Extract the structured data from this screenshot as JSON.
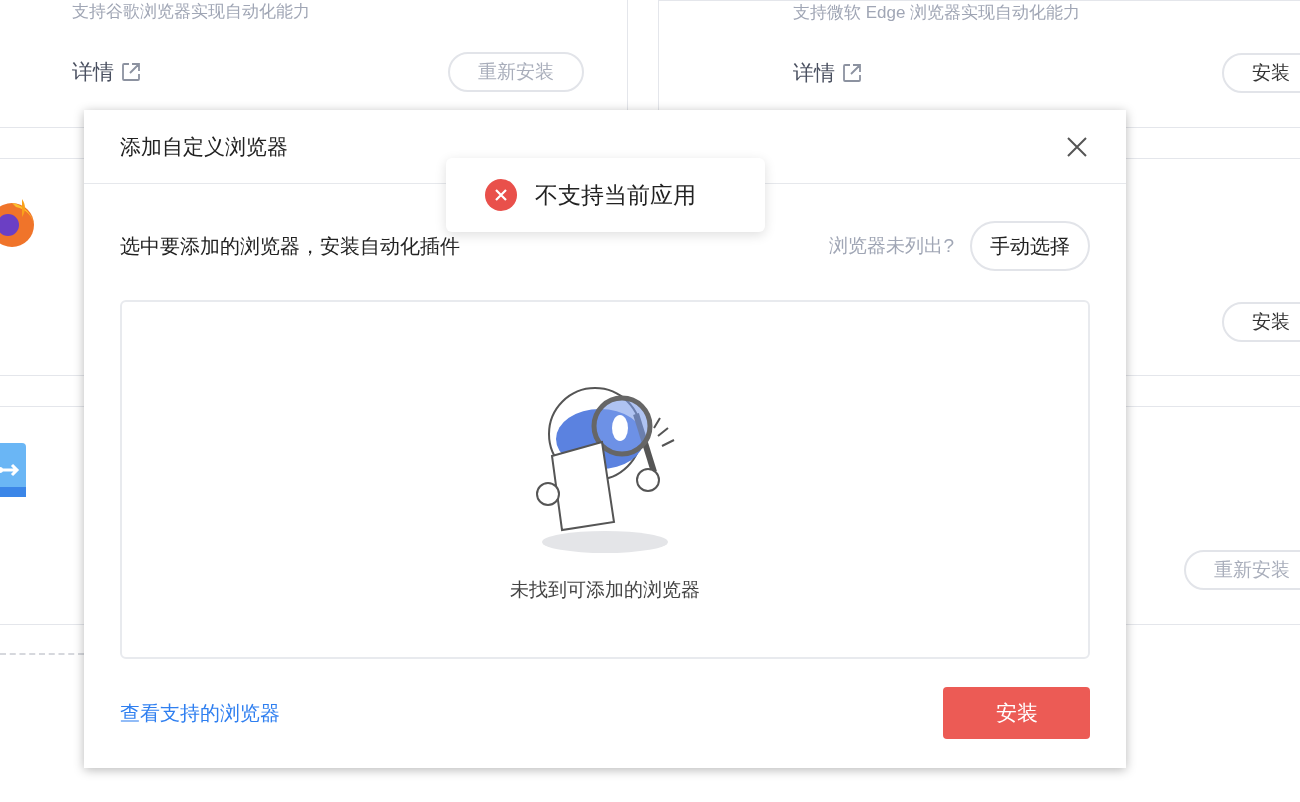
{
  "background": {
    "left_cards": [
      {
        "kind": "plain",
        "description": "支持谷歌浏览器实现自动化能力",
        "details": "详情",
        "button": {
          "label": "重新安装",
          "installed": true
        }
      },
      {
        "kind": "flame"
      },
      {
        "kind": "tile"
      }
    ],
    "right_cards": [
      {
        "description": "支持微软 Edge 浏览器实现自动化能力",
        "details": "详情",
        "button": {
          "label": "安装",
          "installed": false
        }
      },
      {
        "button": {
          "label": "安装",
          "installed": false
        }
      },
      {
        "button": {
          "label": "重新安装",
          "installed": true
        }
      }
    ]
  },
  "dialog": {
    "title": "添加自定义浏览器",
    "instruction": "选中要添加的浏览器，安装自动化插件",
    "hint": "浏览器未列出?",
    "manual_button": "手动选择",
    "empty_message": "未找到可添加的浏览器",
    "footer_link": "查看支持的浏览器",
    "install_button": "安装"
  },
  "toast": {
    "kind": "error",
    "message": "不支持当前应用"
  }
}
